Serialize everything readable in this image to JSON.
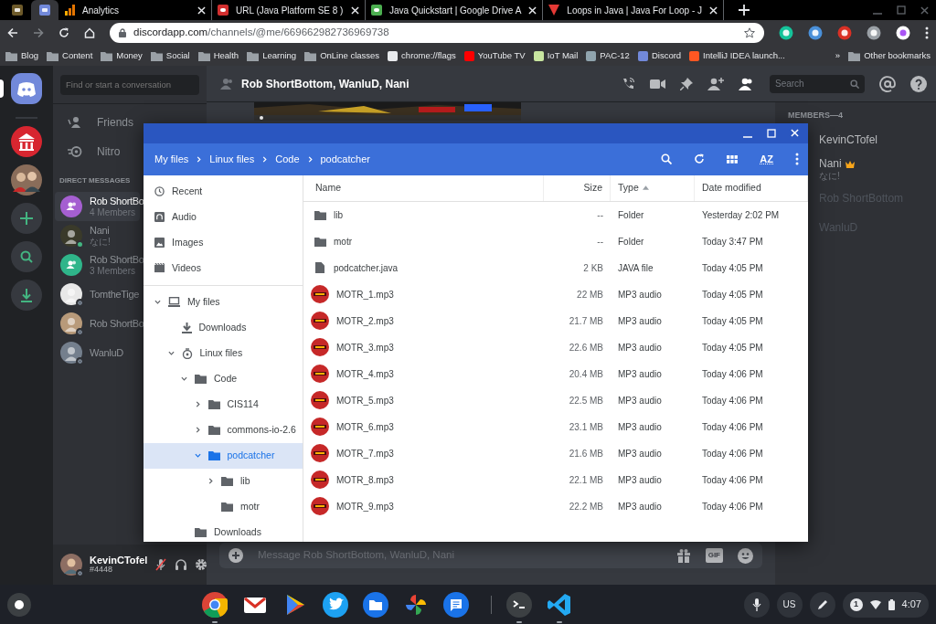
{
  "browser": {
    "tabs": [
      {
        "kind": "pinned",
        "selected": false
      },
      {
        "kind": "pinned",
        "selected": true
      },
      {
        "kind": "page",
        "title": "Analytics",
        "selected": false
      },
      {
        "kind": "page",
        "title": "URL (Java Platform SE 8 )",
        "selected": false
      },
      {
        "kind": "page",
        "title": "Java Quickstart | Google Drive A",
        "selected": false
      },
      {
        "kind": "page",
        "title": "Loops in Java | Java For Loop - J",
        "selected": false
      }
    ],
    "address": {
      "host": "discordapp.com",
      "path": "/channels/@me/669662982736969738"
    },
    "bookmarks": [
      {
        "kind": "folder",
        "label": "Blog"
      },
      {
        "kind": "folder",
        "label": "Content"
      },
      {
        "kind": "folder",
        "label": "Money"
      },
      {
        "kind": "folder",
        "label": "Social"
      },
      {
        "kind": "folder",
        "label": "Health"
      },
      {
        "kind": "folder",
        "label": "Learning"
      },
      {
        "kind": "folder",
        "label": "OnLine classes"
      },
      {
        "kind": "link",
        "label": "chrome://flags"
      },
      {
        "kind": "link",
        "label": "YouTube TV"
      },
      {
        "kind": "link",
        "label": "IoT Mail"
      },
      {
        "kind": "link",
        "label": "PAC-12"
      },
      {
        "kind": "link",
        "label": "Discord"
      },
      {
        "kind": "link",
        "label": "IntelliJ IDEA launch..."
      }
    ],
    "bookmarks_overflow": "»",
    "other_bookmarks": "Other bookmarks"
  },
  "discord": {
    "servers": [
      {
        "kind": "home",
        "selected": true
      },
      {
        "kind": "server",
        "selected": false
      },
      {
        "kind": "server",
        "selected": false
      }
    ],
    "search_placeholder": "Find or start a conversation",
    "nav": [
      {
        "kind": "friends",
        "label": "Friends"
      },
      {
        "kind": "nitro",
        "label": "Nitro"
      }
    ],
    "dm_heading": "DIRECT MESSAGES",
    "dms": [
      {
        "kind": "group",
        "name": "Rob ShortBo",
        "sub": "4 Members",
        "color": "#a55fd1",
        "selected": true
      },
      {
        "kind": "user",
        "name": "Nani",
        "sub": "なに!",
        "color": "#3a3a2a",
        "online": true,
        "selected": false
      },
      {
        "kind": "group",
        "name": "Rob ShortBo",
        "sub": "3 Members",
        "color": "#2fb58a",
        "selected": false
      },
      {
        "kind": "user",
        "name": "TomtheTige",
        "color": "#e8e8e8",
        "online": false,
        "selected": false
      },
      {
        "kind": "user",
        "name": "Rob ShortBo",
        "color": "#b89a7a",
        "online": false,
        "selected": false
      },
      {
        "kind": "user",
        "name": "WanluD",
        "color": "#747f8d",
        "online": false,
        "selected": false
      }
    ],
    "user": {
      "name": "KevinCTofel",
      "tag": "#4448",
      "muted": true
    },
    "channel": {
      "title": "Rob ShortBottom, WanluD, Nani",
      "search_placeholder": "Search",
      "message_placeholder": "Message Rob ShortBottom, WanluD, Nani",
      "gif_label": "GIF"
    },
    "members": {
      "heading": "MEMBERS—4",
      "items": [
        {
          "name": "KevinCTofel",
          "online": true,
          "owner": false
        },
        {
          "name": "Nani",
          "sub": "なに!",
          "online": true,
          "owner": true
        },
        {
          "name": "Rob ShortBottom",
          "online": false,
          "owner": false
        },
        {
          "name": "WanluD",
          "online": false,
          "owner": false
        }
      ]
    }
  },
  "files": {
    "breadcrumb": [
      "My files",
      "Linux files",
      "Code",
      "podcatcher"
    ],
    "sort_button": "AZ",
    "places": [
      {
        "kind": "recent",
        "label": "Recent",
        "selected": false
      },
      {
        "kind": "audio",
        "label": "Audio",
        "selected": false
      },
      {
        "kind": "images",
        "label": "Images",
        "selected": false
      },
      {
        "kind": "videos",
        "label": "Videos",
        "selected": false
      }
    ],
    "tree": [
      {
        "kind": "computer",
        "label": "My files",
        "expanded": true,
        "selected": false,
        "children": [
          {
            "kind": "download",
            "label": "Downloads",
            "selected": false
          },
          {
            "kind": "linux",
            "label": "Linux files",
            "expanded": true,
            "selected": false,
            "children": [
              {
                "kind": "folder",
                "label": "Code",
                "expanded": true,
                "selected": false,
                "children": [
                  {
                    "kind": "folder",
                    "label": "CIS114",
                    "expanded": false,
                    "selected": false
                  },
                  {
                    "kind": "folder",
                    "label": "commons-io-2.6",
                    "expanded": false,
                    "selected": false
                  },
                  {
                    "kind": "folder",
                    "label": "podcatcher",
                    "expanded": true,
                    "selected": true,
                    "children": [
                      {
                        "kind": "folder",
                        "label": "lib",
                        "expanded": false,
                        "selected": false
                      },
                      {
                        "kind": "folder",
                        "label": "motr",
                        "selected": false
                      }
                    ]
                  }
                ]
              },
              {
                "kind": "folder",
                "label": "Downloads",
                "selected": false
              }
            ]
          }
        ]
      }
    ],
    "columns": [
      {
        "label": "Name",
        "sorted": false
      },
      {
        "label": "Size",
        "sorted": false
      },
      {
        "label": "Type",
        "sorted": true
      },
      {
        "label": "Date modified",
        "sorted": false
      }
    ],
    "rows": [
      {
        "kind": "folder",
        "name": "lib",
        "size": "--",
        "type": "Folder",
        "modified": "Yesterday 2:02 PM"
      },
      {
        "kind": "folder",
        "name": "motr",
        "size": "--",
        "type": "Folder",
        "modified": "Today 3:47 PM"
      },
      {
        "kind": "file",
        "name": "podcatcher.java",
        "size": "2 KB",
        "type": "JAVA file",
        "modified": "Today 4:05 PM"
      },
      {
        "kind": "audio",
        "name": "MOTR_1.mp3",
        "size": "22 MB",
        "type": "MP3 audio",
        "modified": "Today 4:05 PM"
      },
      {
        "kind": "audio",
        "name": "MOTR_2.mp3",
        "size": "21.7 MB",
        "type": "MP3 audio",
        "modified": "Today 4:05 PM"
      },
      {
        "kind": "audio",
        "name": "MOTR_3.mp3",
        "size": "22.6 MB",
        "type": "MP3 audio",
        "modified": "Today 4:05 PM"
      },
      {
        "kind": "audio",
        "name": "MOTR_4.mp3",
        "size": "20.4 MB",
        "type": "MP3 audio",
        "modified": "Today 4:06 PM"
      },
      {
        "kind": "audio",
        "name": "MOTR_5.mp3",
        "size": "22.5 MB",
        "type": "MP3 audio",
        "modified": "Today 4:06 PM"
      },
      {
        "kind": "audio",
        "name": "MOTR_6.mp3",
        "size": "23.1 MB",
        "type": "MP3 audio",
        "modified": "Today 4:06 PM"
      },
      {
        "kind": "audio",
        "name": "MOTR_7.mp3",
        "size": "21.6 MB",
        "type": "MP3 audio",
        "modified": "Today 4:06 PM"
      },
      {
        "kind": "audio",
        "name": "MOTR_8.mp3",
        "size": "22.1 MB",
        "type": "MP3 audio",
        "modified": "Today 4:06 PM"
      },
      {
        "kind": "audio",
        "name": "MOTR_9.mp3",
        "size": "22.2 MB",
        "type": "MP3 audio",
        "modified": "Today 4:06 PM"
      }
    ]
  },
  "shelf": {
    "apps": [
      {
        "kind": "browser",
        "running": true
      },
      {
        "kind": "mail",
        "running": false
      },
      {
        "kind": "store",
        "running": false
      },
      {
        "kind": "bird",
        "running": false
      },
      {
        "kind": "files",
        "running": false
      },
      {
        "kind": "photos",
        "running": false
      },
      {
        "kind": "messages",
        "running": false
      },
      {
        "kind": "terminal",
        "running": true
      },
      {
        "kind": "editor",
        "running": true
      }
    ],
    "ime": "US",
    "notifications": "1",
    "time": "4:07"
  }
}
